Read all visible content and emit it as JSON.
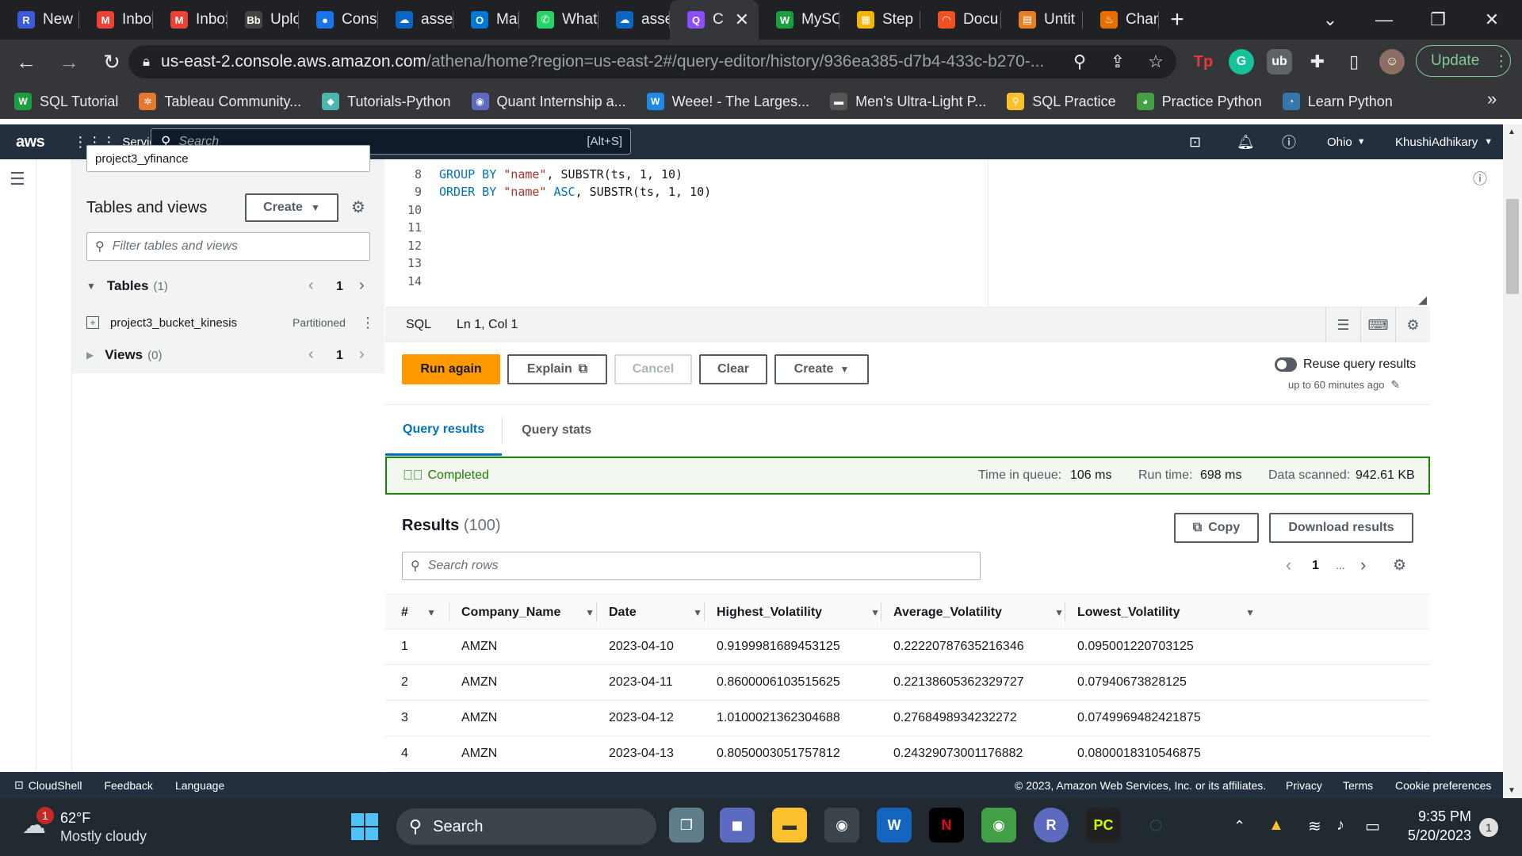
{
  "browser": {
    "tabs": [
      {
        "label": "New",
        "icon": "R",
        "color": "#3b5bdb"
      },
      {
        "label": "Inbox",
        "icon": "M",
        "color": "#ea4335"
      },
      {
        "label": "Inbox",
        "icon": "M",
        "color": "#ea4335"
      },
      {
        "label": "Uploa",
        "icon": "Bb",
        "color": "#444"
      },
      {
        "label": "Cons",
        "icon": "●",
        "color": "#1a73e8"
      },
      {
        "label": "asset",
        "icon": "☁",
        "color": "#0a66c2"
      },
      {
        "label": "Mail",
        "icon": "O",
        "color": "#0078d4"
      },
      {
        "label": "What",
        "icon": "✆",
        "color": "#25d366"
      },
      {
        "label": "asset",
        "icon": "☁",
        "color": "#0a66c2"
      },
      {
        "label": "C",
        "icon": "Q",
        "color": "#8c4fff"
      },
      {
        "label": "MySC",
        "icon": "W",
        "color": "#1b9e3e"
      },
      {
        "label": "Step",
        "icon": "▦",
        "color": "#f4b400"
      },
      {
        "label": "Docu",
        "icon": "◠",
        "color": "#f25022"
      },
      {
        "label": "Untit",
        "icon": "▤",
        "color": "#e67e22"
      },
      {
        "label": "Chan",
        "icon": "♨",
        "color": "#e76f00"
      }
    ],
    "active_tab_index": 9,
    "url_host": "us-east-2.console.aws.amazon.com",
    "url_path": "/athena/home?region=us-east-2#/query-editor/history/936ea385-d7b4-433c-b270-...",
    "update_label": "Update",
    "bookmarks": [
      {
        "label": "SQL Tutorial",
        "icon": "W",
        "color": "#1b9e3e"
      },
      {
        "label": "Tableau Community...",
        "icon": "✲",
        "color": "#e8762c"
      },
      {
        "label": "Tutorials-Python",
        "icon": "◆",
        "color": "#4db6ac"
      },
      {
        "label": "Quant Internship a...",
        "icon": "◉",
        "color": "#5c6bc0"
      },
      {
        "label": "Weee! - The Larges...",
        "icon": "W",
        "color": "#1e88e5"
      },
      {
        "label": "Men's Ultra-Light P...",
        "icon": "▬",
        "color": "#555"
      },
      {
        "label": "SQL Practice",
        "icon": "⚲",
        "color": "#fbc02d"
      },
      {
        "label": "Practice Python",
        "icon": "◕",
        "color": "#43a047"
      },
      {
        "label": "Learn Python",
        "icon": "◔",
        "color": "#3776ab"
      }
    ],
    "more_bookmarks": "»"
  },
  "aws": {
    "logo": "aws",
    "services_label": "Services",
    "search_placeholder": "Search",
    "search_shortcut": "[Alt+S]",
    "region": "Ohio",
    "user": "KhushiAdhikary",
    "footer": {
      "cloudshell": "CloudShell",
      "feedback": "Feedback",
      "language": "Language",
      "copyright": "© 2023, Amazon Web Services, Inc. or its affiliates.",
      "privacy": "Privacy",
      "terms": "Terms",
      "cookie": "Cookie preferences"
    }
  },
  "sidepanel": {
    "database_value": "project3_yfinance",
    "title": "Tables and views",
    "create_label": "Create",
    "filter_placeholder": "Filter tables and views",
    "tables_label": "Tables",
    "tables_count": "(1)",
    "tables_page": "1",
    "table_name": "project3_bucket_kinesis",
    "table_badge": "Partitioned",
    "views_label": "Views",
    "views_count": "(0)",
    "views_page": "1"
  },
  "editor": {
    "lines": [
      "8",
      "9",
      "10",
      "11",
      "12",
      "13",
      "14"
    ],
    "line8_kw": "GROUP BY",
    "line8_str": "\"name\"",
    "line8_rest": ", SUBSTR(ts, 1, 10)",
    "line9_kw": "ORDER BY",
    "line9_str": "\"name\"",
    "line9_asc": "ASC",
    "line9_rest": ", SUBSTR(ts, 1, 10)",
    "language": "SQL",
    "cursor": "Ln 1, Col 1"
  },
  "actions": {
    "run_again": "Run again",
    "explain": "Explain",
    "cancel": "Cancel",
    "clear": "Clear",
    "create": "Create",
    "reuse_label": "Reuse query results",
    "reuse_sub": "up to 60 minutes ago"
  },
  "result_tabs": {
    "query_results": "Query results",
    "query_stats": "Query stats"
  },
  "status": {
    "completed": "Completed",
    "queue_label": "Time in queue:",
    "queue_value": "106 ms",
    "run_label": "Run time:",
    "run_value": "698 ms",
    "scanned_label": "Data scanned:",
    "scanned_value": "942.61 KB"
  },
  "results": {
    "title": "Results",
    "count": "(100)",
    "copy_label": "Copy",
    "download_label": "Download results",
    "search_placeholder": "Search rows",
    "page": "1",
    "ellipsis": "...",
    "columns": [
      "#",
      "Company_Name",
      "Date",
      "Highest_Volatility",
      "Average_Volatility",
      "Lowest_Volatility"
    ],
    "rows": [
      [
        "1",
        "AMZN",
        "2023-04-10",
        "0.9199981689453125",
        "0.22220787635216346",
        "0.095001220703125"
      ],
      [
        "2",
        "AMZN",
        "2023-04-11",
        "0.8600006103515625",
        "0.22138605362329727",
        "0.07940673828125"
      ],
      [
        "3",
        "AMZN",
        "2023-04-12",
        "1.0100021362304688",
        "0.2768498934232272",
        "0.0749969482421875"
      ],
      [
        "4",
        "AMZN",
        "2023-04-13",
        "0.8050003051757812",
        "0.24329073001176882",
        "0.0800018310546875"
      ]
    ]
  },
  "taskbar": {
    "weather_badge": "1",
    "temperature": "62°F",
    "condition": "Mostly cloudy",
    "search": "Search",
    "time": "9:35 PM",
    "date": "5/20/2023",
    "notification_count": "1"
  }
}
